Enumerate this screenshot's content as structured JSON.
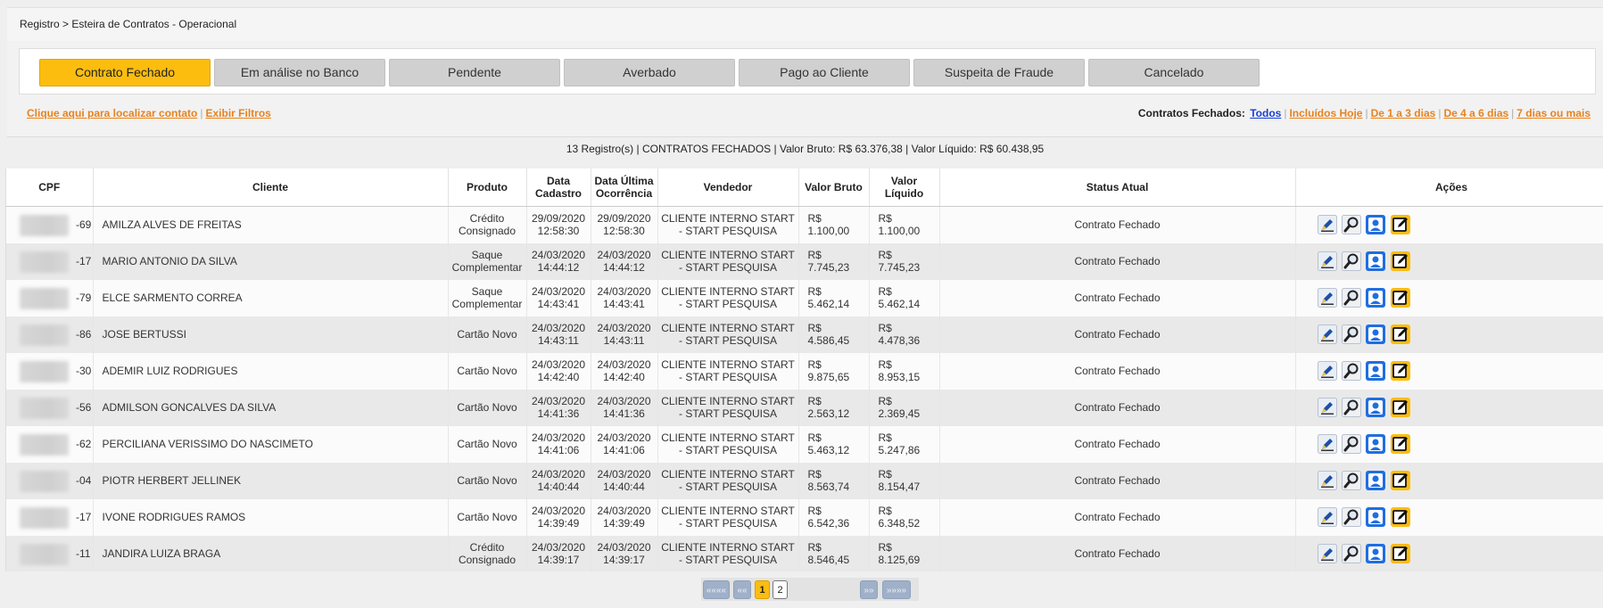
{
  "breadcrumb": "Registro > Esteira de Contratos - Operacional",
  "tabs": [
    {
      "label": "Contrato Fechado",
      "active": true
    },
    {
      "label": "Em análise no Banco",
      "active": false
    },
    {
      "label": "Pendente",
      "active": false
    },
    {
      "label": "Averbado",
      "active": false
    },
    {
      "label": "Pago ao Cliente",
      "active": false
    },
    {
      "label": "Suspeita de Fraude",
      "active": false
    },
    {
      "label": "Cancelado",
      "active": false
    }
  ],
  "links": {
    "locate_contact": "Clique aqui para localizar contato",
    "show_filters": "Exibir Filtros"
  },
  "filter": {
    "label": "Contratos Fechados:",
    "options": [
      "Todos",
      "Incluídos Hoje",
      "De 1 a 3 dias",
      "De 4 a 6 dias",
      "7 dias ou mais"
    ]
  },
  "summary": "13 Registro(s) | CONTRATOS FECHADOS | Valor Bruto: R$ 63.376,38 | Valor Líquido: R$ 60.438,95",
  "table": {
    "headers": [
      "CPF",
      "Cliente",
      "Produto",
      "Data Cadastro",
      "Data Última Ocorrência",
      "Vendedor",
      "Valor Bruto",
      "Valor Líquido",
      "Status Atual",
      "Ações"
    ],
    "rows": [
      {
        "cpf": "-69",
        "cliente": "AMILZA ALVES DE FREITAS",
        "produto": "Crédito Consignado",
        "cadastro": "29/09/2020 12:58:30",
        "ocorrencia": "29/09/2020 12:58:30",
        "vendedor": "CLIENTE INTERNO START - START PESQUISA",
        "bruto": "R$ 1.100,00",
        "liquido": "R$ 1.100,00",
        "status": "Contrato Fechado"
      },
      {
        "cpf": "-17",
        "cliente": "MARIO ANTONIO DA SILVA",
        "produto": "Saque Complementar",
        "cadastro": "24/03/2020 14:44:12",
        "ocorrencia": "24/03/2020 14:44:12",
        "vendedor": "CLIENTE INTERNO START - START PESQUISA",
        "bruto": "R$ 7.745,23",
        "liquido": "R$ 7.745,23",
        "status": "Contrato Fechado"
      },
      {
        "cpf": "-79",
        "cliente": "ELCE SARMENTO CORREA",
        "produto": "Saque Complementar",
        "cadastro": "24/03/2020 14:43:41",
        "ocorrencia": "24/03/2020 14:43:41",
        "vendedor": "CLIENTE INTERNO START - START PESQUISA",
        "bruto": "R$ 5.462,14",
        "liquido": "R$ 5.462,14",
        "status": "Contrato Fechado"
      },
      {
        "cpf": "-86",
        "cliente": "JOSE BERTUSSI",
        "produto": "Cartão Novo",
        "cadastro": "24/03/2020 14:43:11",
        "ocorrencia": "24/03/2020 14:43:11",
        "vendedor": "CLIENTE INTERNO START - START PESQUISA",
        "bruto": "R$ 4.586,45",
        "liquido": "R$ 4.478,36",
        "status": "Contrato Fechado"
      },
      {
        "cpf": "-30",
        "cliente": "ADEMIR LUIZ RODRIGUES",
        "produto": "Cartão Novo",
        "cadastro": "24/03/2020 14:42:40",
        "ocorrencia": "24/03/2020 14:42:40",
        "vendedor": "CLIENTE INTERNO START - START PESQUISA",
        "bruto": "R$ 9.875,65",
        "liquido": "R$ 8.953,15",
        "status": "Contrato Fechado"
      },
      {
        "cpf": "-56",
        "cliente": "ADMILSON GONCALVES DA SILVA",
        "produto": "Cartão Novo",
        "cadastro": "24/03/2020 14:41:36",
        "ocorrencia": "24/03/2020 14:41:36",
        "vendedor": "CLIENTE INTERNO START - START PESQUISA",
        "bruto": "R$ 2.563,12",
        "liquido": "R$ 2.369,45",
        "status": "Contrato Fechado"
      },
      {
        "cpf": "-62",
        "cliente": "PERCILIANA VERISSIMO DO NASCIMETO",
        "produto": "Cartão Novo",
        "cadastro": "24/03/2020 14:41:06",
        "ocorrencia": "24/03/2020 14:41:06",
        "vendedor": "CLIENTE INTERNO START - START PESQUISA",
        "bruto": "R$ 5.463,12",
        "liquido": "R$ 5.247,86",
        "status": "Contrato Fechado"
      },
      {
        "cpf": "-04",
        "cliente": "PIOTR HERBERT JELLINEK",
        "produto": "Cartão Novo",
        "cadastro": "24/03/2020 14:40:44",
        "ocorrencia": "24/03/2020 14:40:44",
        "vendedor": "CLIENTE INTERNO START - START PESQUISA",
        "bruto": "R$ 8.563,74",
        "liquido": "R$ 8.154,47",
        "status": "Contrato Fechado"
      },
      {
        "cpf": "-17",
        "cliente": "IVONE RODRIGUES RAMOS",
        "produto": "Cartão Novo",
        "cadastro": "24/03/2020 14:39:49",
        "ocorrencia": "24/03/2020 14:39:49",
        "vendedor": "CLIENTE INTERNO START - START PESQUISA",
        "bruto": "R$ 6.542,36",
        "liquido": "R$ 6.348,52",
        "status": "Contrato Fechado"
      },
      {
        "cpf": "-11",
        "cliente": "JANDIRA LUIZA BRAGA",
        "produto": "Crédito Consignado",
        "cadastro": "24/03/2020 14:39:17",
        "ocorrencia": "24/03/2020 14:39:17",
        "vendedor": "CLIENTE INTERNO START - START PESQUISA",
        "bruto": "R$ 8.546,45",
        "liquido": "R$ 8.125,69",
        "status": "Contrato Fechado"
      }
    ],
    "action_icons": [
      "edit-pencil-icon",
      "search-magnifier-icon",
      "user-profile-icon",
      "edit-note-icon"
    ]
  },
  "pagination": {
    "first": "««««",
    "prev": "««",
    "pages": [
      "1",
      "2"
    ],
    "current": "1",
    "next": "»»",
    "last": "»»»»"
  },
  "colors": {
    "active_tab": "#fcbd0f",
    "link_orange": "#e8821c",
    "link_blue": "#1a3fd6",
    "pager_nav": "#9fb0c8"
  }
}
